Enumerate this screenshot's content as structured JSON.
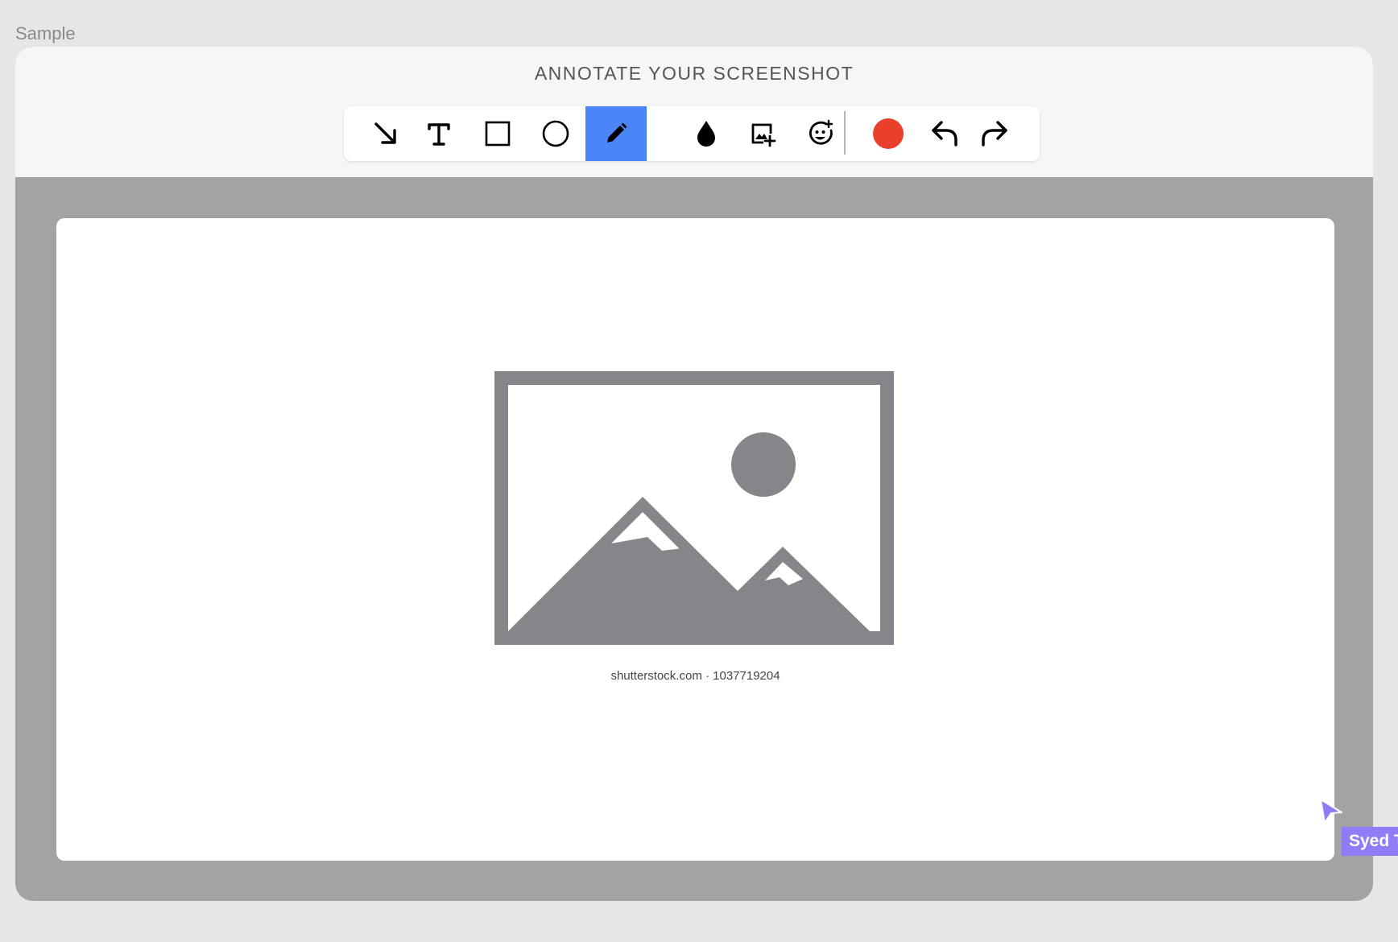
{
  "frame": {
    "label": "Sample"
  },
  "header": {
    "title": "ANNOTATE YOUR SCREENSHOT"
  },
  "toolbar": {
    "tools": [
      {
        "name": "arrow",
        "icon": "arrow-diagonal-icon",
        "active": false
      },
      {
        "name": "text",
        "icon": "text-icon",
        "active": false
      },
      {
        "name": "rectangle",
        "icon": "square-icon",
        "active": false
      },
      {
        "name": "ellipse",
        "icon": "circle-icon",
        "active": false
      },
      {
        "name": "pen",
        "icon": "pencil-icon",
        "active": true
      },
      {
        "name": "blur",
        "icon": "droplet-icon",
        "active": false
      },
      {
        "name": "add-image",
        "icon": "image-add-icon",
        "active": false
      },
      {
        "name": "add-emoji",
        "icon": "emoji-add-icon",
        "active": false
      }
    ],
    "color": "#e8402a",
    "active_color": "#4a86f7",
    "actions": [
      {
        "name": "undo",
        "icon": "undo-icon"
      },
      {
        "name": "redo",
        "icon": "redo-icon"
      }
    ]
  },
  "canvas": {
    "image": {
      "icon": "image-placeholder-icon"
    },
    "caption": "shutterstock.com · 1037719204"
  },
  "collaborator": {
    "name": "Syed T",
    "color": "#8f7cf6"
  }
}
